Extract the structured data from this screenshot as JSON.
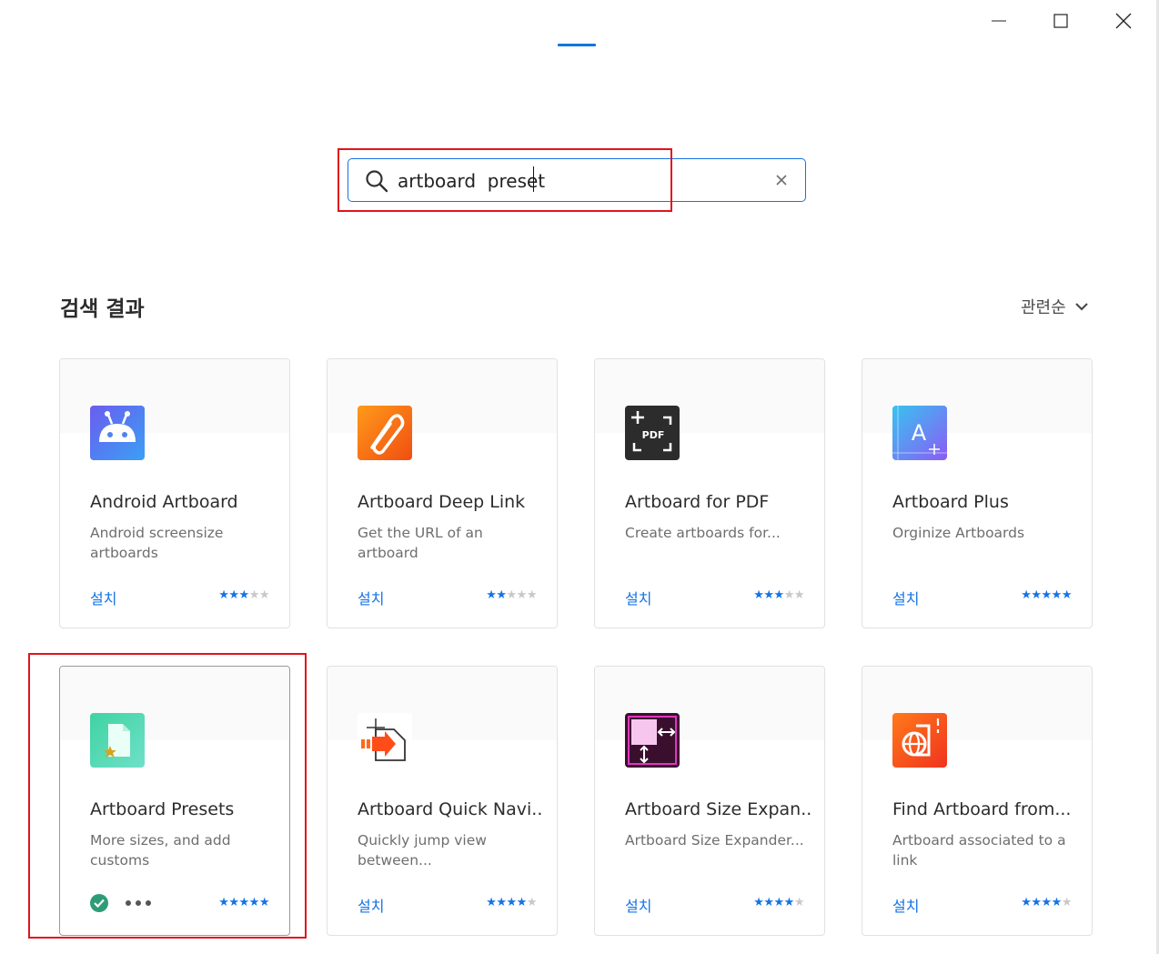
{
  "search": {
    "value": "artboard  preset",
    "clear_label": "×"
  },
  "results": {
    "title": "검색 결과",
    "sort_label": "관련순"
  },
  "colors": {
    "accent": "#1473e6",
    "highlight": "#e0141c",
    "installed": "#2d9d78"
  },
  "plugins": [
    {
      "name": "Android Artboard",
      "desc": "Android screensize artboards",
      "action": "설치",
      "rating": 3,
      "icon": "android-icon"
    },
    {
      "name": "Artboard Deep Link",
      "desc": "Get the URL of an artboard",
      "action": "설치",
      "rating": 2,
      "icon": "paperclip-icon"
    },
    {
      "name": "Artboard for PDF",
      "desc": "Create artboards for...",
      "action": "설치",
      "rating": 3,
      "icon": "pdf-frame-icon"
    },
    {
      "name": "Artboard Plus",
      "desc": "Orginize Artboards",
      "action": "설치",
      "rating": 5,
      "icon": "artboard-plus-icon"
    },
    {
      "name": "Artboard Presets",
      "desc": "More sizes, and add customs",
      "action": "installed",
      "rating": 5,
      "icon": "document-star-icon"
    },
    {
      "name": "Artboard Quick Navi...",
      "desc": "Quickly jump view between...",
      "action": "설치",
      "rating": 4,
      "icon": "quick-navigate-icon"
    },
    {
      "name": "Artboard Size Expan...",
      "desc": "Artboard Size Expander...",
      "action": "설치",
      "rating": 4,
      "icon": "size-expand-icon"
    },
    {
      "name": "Find Artboard from...",
      "desc": "Artboard associated to a link",
      "action": "설치",
      "rating": 4,
      "icon": "find-link-icon"
    }
  ]
}
